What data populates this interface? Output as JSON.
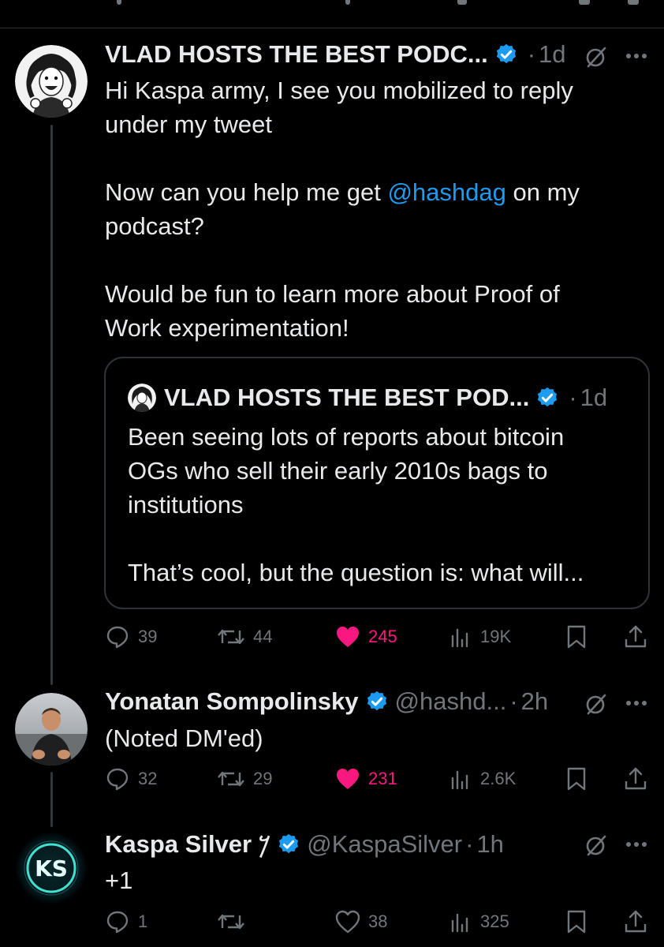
{
  "tweets": [
    {
      "name": "VLAD HOSTS THE BEST PODC...",
      "handle": "",
      "time": "1d",
      "text_parts": [
        "Hi Kaspa army, I see you mobilized to reply\nunder my tweet\n\nNow can you help me get ",
        "@hashdag",
        " on my\npodcast?\n\nWould be fun to learn more about Proof of\nWork experimentation!"
      ],
      "quote": {
        "name": "VLAD HOSTS THE BEST POD...",
        "time": "1d",
        "text": "Been seeing lots of reports about bitcoin\nOGs who sell their early 2010s bags to\ninstitutions\n\nThat’s cool, but the question is: what will..."
      },
      "replies": "39",
      "reposts": "44",
      "likes": "245",
      "liked": true,
      "views": "19K"
    },
    {
      "name": "Yonatan Sompolinsky",
      "handle": "@hashd...",
      "time": "2h",
      "text": "(Noted DM'ed)",
      "replies": "32",
      "reposts": "29",
      "likes": "231",
      "liked": true,
      "views": "2.6K"
    },
    {
      "name": "Kaspa Silver 𐤊",
      "handle": "@KaspaSilver",
      "time": "1h",
      "text": "+1",
      "replies": "1",
      "reposts": "",
      "likes": "38",
      "liked": false,
      "views": "325"
    }
  ],
  "separator": "·",
  "icons": {
    "verified": "verified-badge-icon",
    "grok": "grok-icon",
    "more": "more-options-icon",
    "reply": "reply-icon",
    "repost": "repost-icon",
    "like": "like-icon",
    "views": "views-icon",
    "bookmark": "bookmark-icon",
    "share": "share-icon",
    "avatar_logo": "KS"
  },
  "colors": {
    "background": "#000000",
    "text": "#e7e9ea",
    "muted": "#71767b",
    "link": "#1d9bf0",
    "like_active": "#f91880",
    "verified": "#1d9bf0",
    "border": "#2f3336"
  }
}
